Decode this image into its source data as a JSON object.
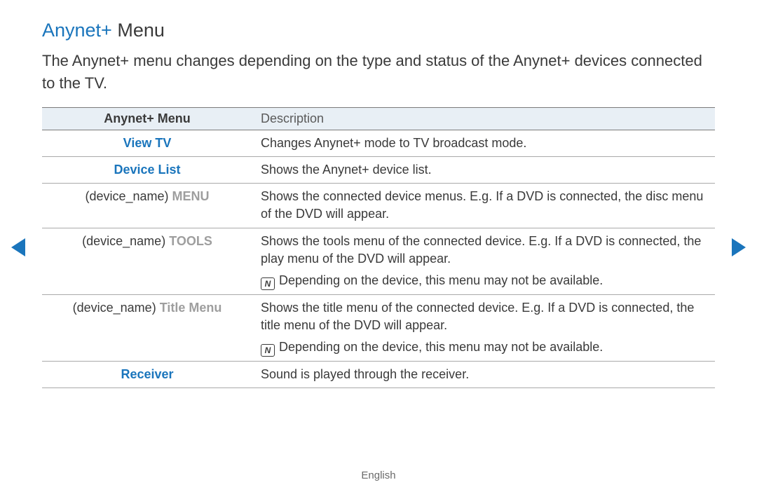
{
  "title_accent": "Anynet+",
  "title_rest": " Menu",
  "intro": "The Anynet+ menu changes depending on the type and status of the Anynet+ devices connected to the TV.",
  "table_header_left": "Anynet+ Menu",
  "table_header_right": "Description",
  "rows": [
    {
      "label_prefix": "",
      "label_main": "View TV",
      "label_class": "blue-bold",
      "desc": "Changes Anynet+ mode to TV broadcast mode."
    },
    {
      "label_prefix": "",
      "label_main": "Device List",
      "label_class": "blue-bold",
      "desc": "Shows the Anynet+ device list."
    },
    {
      "label_prefix": "(device_name) ",
      "label_main": "MENU",
      "label_class": "gray-bold",
      "desc": "Shows the connected device menus. E.g. If a DVD is connected, the disc menu of the DVD will appear."
    },
    {
      "label_prefix": "(device_name) ",
      "label_main": "TOOLS",
      "label_class": "gray-bold",
      "desc": "Shows the tools menu of the connected device. E.g. If a DVD is connected, the play menu of the DVD will appear.",
      "note": "Depending on the device, this menu may not be available."
    },
    {
      "label_prefix": "(device_name) ",
      "label_main": "Title Menu",
      "label_class": "gray-bold",
      "desc": "Shows the title menu of the connected device. E.g. If a DVD is connected, the title menu of the DVD will appear.",
      "note": "Depending on the device, this menu may not be available."
    },
    {
      "label_prefix": "",
      "label_main": "Receiver",
      "label_class": "blue-bold",
      "desc": "Sound is played through the receiver."
    }
  ],
  "note_icon_glyph": "N",
  "footer": "English"
}
